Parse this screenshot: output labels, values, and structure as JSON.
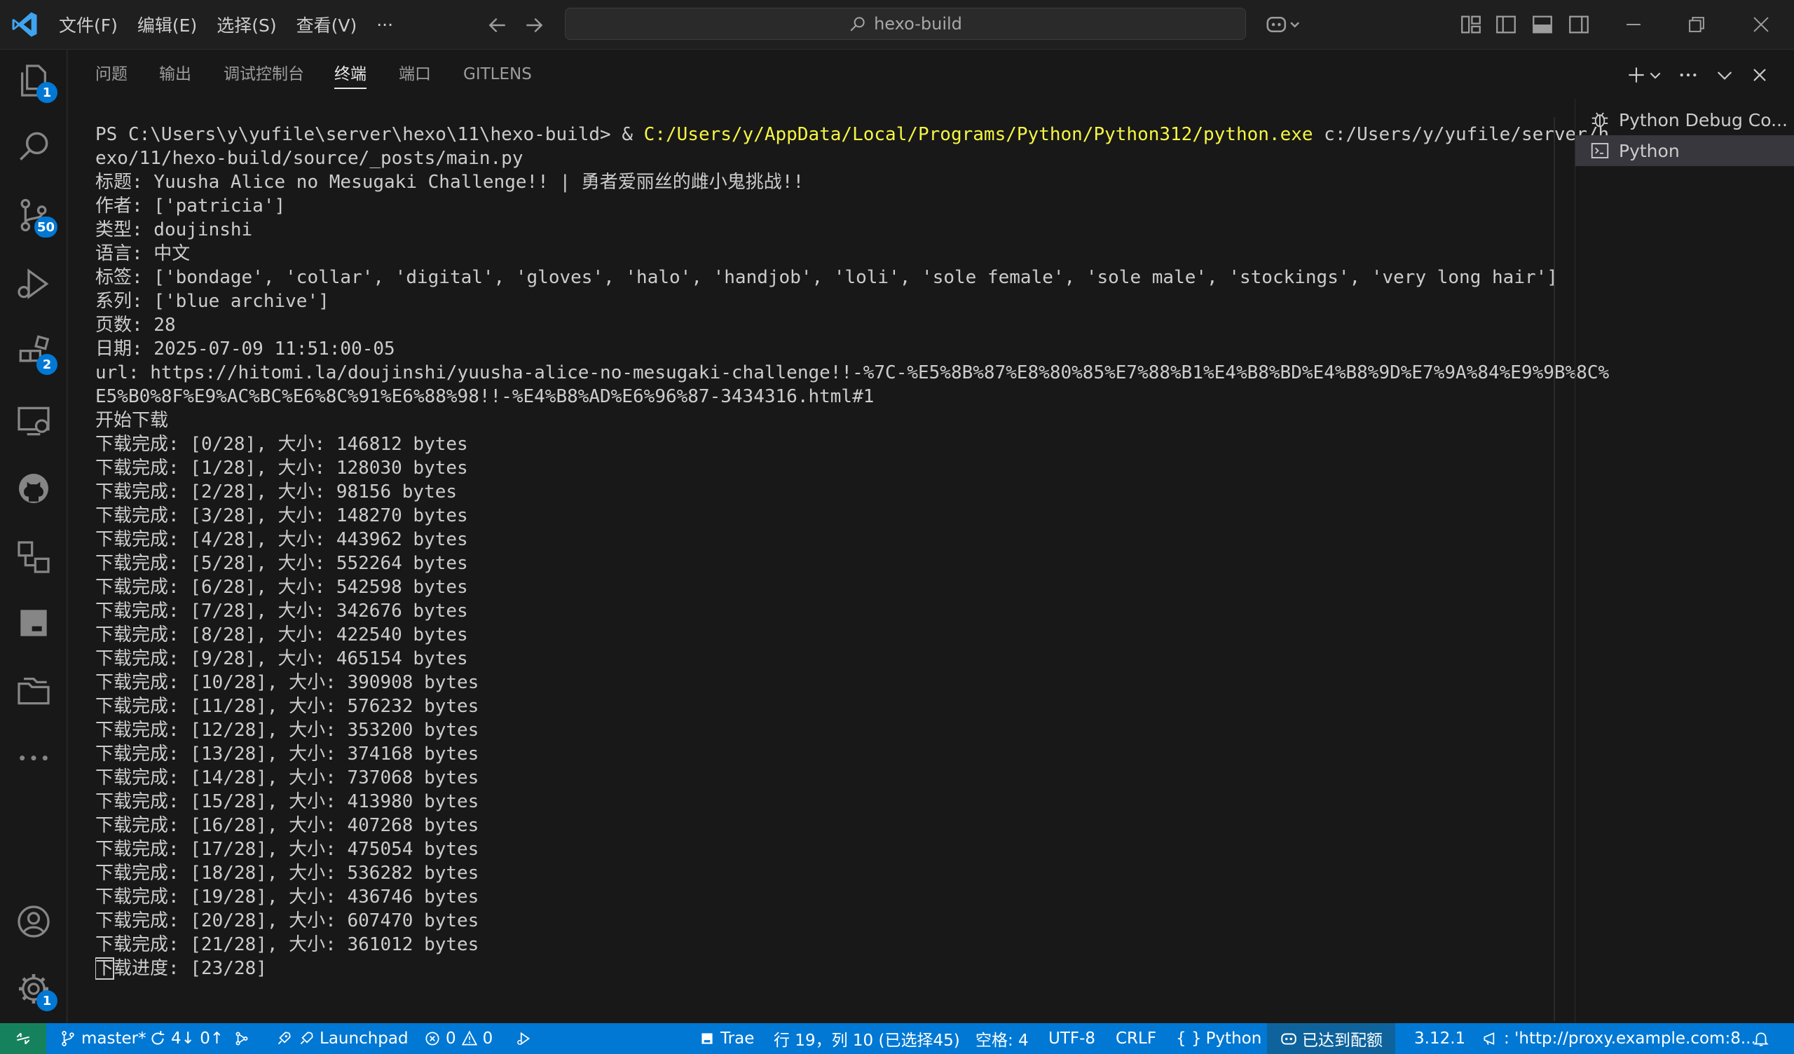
{
  "titlebar": {
    "menu": [
      "文件(F)",
      "编辑(E)",
      "选择(S)",
      "查看(V)",
      "···"
    ],
    "search_text": "hexo-build"
  },
  "activity_bar": {
    "explorer_badge": "1",
    "source_control_badge": "50",
    "extensions_badge": "2",
    "settings_badge": "1"
  },
  "panel": {
    "tabs": [
      "问题",
      "输出",
      "调试控制台",
      "终端",
      "端口",
      "GITLENS"
    ],
    "active_tab": "终端"
  },
  "terminal": {
    "prompt": "PS C:\\Users\\y\\yufile\\server\\hexo\\11\\hexo-build> & ",
    "exe_path": "C:/Users/y/AppData/Local/Programs/Python/Python312/python.exe",
    "script_arg_line1": " c:/Users/y/yufile/server/h",
    "script_arg_line2": "exo/11/hexo-build/source/_posts/main.py",
    "lines": [
      "标题: Yuusha Alice no Mesugaki Challenge!! | 勇者爱丽丝的雌小鬼挑战!!",
      "作者: ['patricia']",
      "类型: doujinshi",
      "语言: 中文",
      "标签: ['bondage', 'collar', 'digital', 'gloves', 'halo', 'handjob', 'loli', 'sole female', 'sole male', 'stockings', 'very long hair']",
      "系列: ['blue archive']",
      "页数: 28",
      "日期: 2025-07-09 11:51:00-05",
      "url: https://hitomi.la/doujinshi/yuusha-alice-no-mesugaki-challenge!!-%7C-%E5%8B%87%E8%80%85%E7%88%B1%E4%B8%BD%E4%B8%9D%E7%9A%84%E9%9B%8C%",
      "E5%B0%8F%E9%AC%BC%E6%8C%91%E6%88%98!!-%E4%B8%AD%E6%96%87-3434316.html#1",
      "开始下载",
      "下载完成: [0/28], 大小: 146812 bytes",
      "下载完成: [1/28], 大小: 128030 bytes",
      "下载完成: [2/28], 大小: 98156 bytes",
      "下载完成: [3/28], 大小: 148270 bytes",
      "下载完成: [4/28], 大小: 443962 bytes",
      "下载完成: [5/28], 大小: 552264 bytes",
      "下载完成: [6/28], 大小: 542598 bytes",
      "下载完成: [7/28], 大小: 342676 bytes",
      "下载完成: [8/28], 大小: 422540 bytes",
      "下载完成: [9/28], 大小: 465154 bytes",
      "下载完成: [10/28], 大小: 390908 bytes",
      "下载完成: [11/28], 大小: 576232 bytes",
      "下载完成: [12/28], 大小: 353200 bytes",
      "下载完成: [13/28], 大小: 374168 bytes",
      "下载完成: [14/28], 大小: 737068 bytes",
      "下载完成: [15/28], 大小: 413980 bytes",
      "下载完成: [16/28], 大小: 407268 bytes",
      "下载完成: [17/28], 大小: 475054 bytes",
      "下载完成: [18/28], 大小: 536282 bytes",
      "下载完成: [19/28], 大小: 436746 bytes",
      "下载完成: [20/28], 大小: 607470 bytes",
      "下载完成: [21/28], 大小: 361012 bytes"
    ],
    "last_line_first_char": "下",
    "last_line_rest": "载进度: [23/28]"
  },
  "terminal_list": [
    {
      "label": "Python Debug Co...",
      "icon": "debug-icon"
    },
    {
      "label": "Python",
      "icon": "terminal-icon"
    }
  ],
  "statusbar": {
    "branch": "master*",
    "sync": "4↓ 0↑",
    "launchpad": "Launchpad",
    "errors": "0",
    "warnings": "0",
    "trae": "Trae",
    "cursor_pos": "行 19，列 10 (已选择45)",
    "indent": "空格: 4",
    "encoding": "UTF-8",
    "eol": "CRLF",
    "language": "Python",
    "quota": "已达到配额",
    "python_version": "3.12.1",
    "proxy": ": 'http://proxy.example.com:8..."
  },
  "colors": {
    "accent": "#0078d4",
    "terminal_yellow": "#f5f543",
    "remote_green": "#16825d"
  }
}
